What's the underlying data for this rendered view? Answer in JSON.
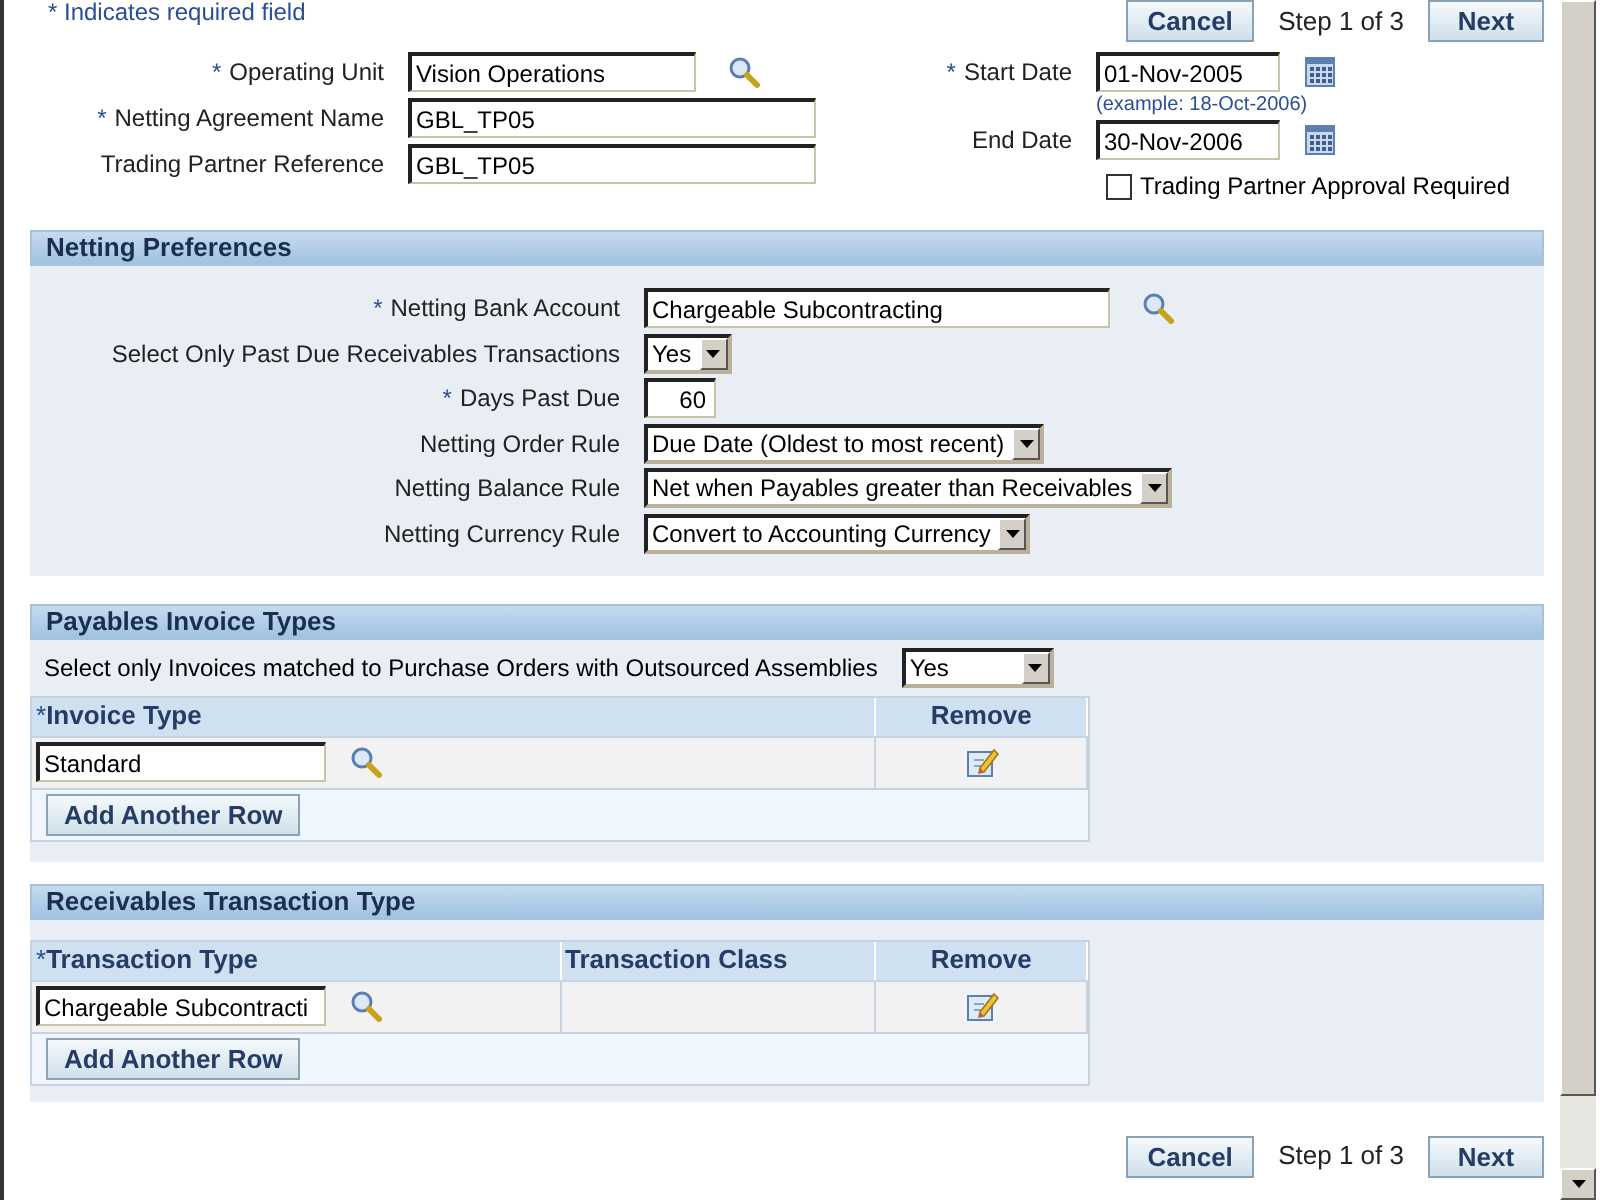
{
  "required_note": "* Indicates required field",
  "top_nav": {
    "cancel": "Cancel",
    "step": "Step 1 of 3",
    "next": "Next"
  },
  "header_left": [
    {
      "label": "Operating Unit",
      "mark": "*",
      "kind": "lov",
      "value": "Vision Operations"
    },
    {
      "label": "Netting Agreement Name",
      "mark": "*",
      "kind": "text",
      "value": "GBL_TP05"
    },
    {
      "label": "Trading Partner Reference",
      "kind": "text",
      "value": "GBL_TP05"
    }
  ],
  "header_right": [
    {
      "label": "Start Date",
      "mark": "*",
      "kind": "date",
      "value": "01-Nov-2005",
      "hint": "(example: 18-Oct-2006)"
    },
    {
      "label": "End Date",
      "kind": "date",
      "value": "30-Nov-2006"
    }
  ],
  "approval_checkbox": {
    "label": "Trading Partner Approval Required",
    "checked": false
  },
  "netting_preferences": {
    "title": "Netting Preferences",
    "fields": [
      {
        "label": "Netting Bank Account",
        "mark": "*",
        "kind": "lov",
        "value": "Chargeable Subcontracting"
      },
      {
        "label": "Select Only Past Due Receivables Transactions",
        "kind": "select",
        "value": "Yes"
      },
      {
        "label": "Days Past Due",
        "mark": "*",
        "kind": "number",
        "value": "60"
      },
      {
        "label": "Netting Order Rule",
        "kind": "select",
        "value": "Due Date (Oldest to most recent)"
      },
      {
        "label": "Netting Balance Rule",
        "kind": "select",
        "value": "Net when Payables greater than Receivables"
      },
      {
        "label": "Netting Currency Rule",
        "kind": "select",
        "value": "Convert to Accounting Currency"
      }
    ]
  },
  "payables_invoice_types": {
    "title": "Payables Invoice Types",
    "filter": {
      "label": "Select only Invoices matched to Purchase Orders with Outsourced Assemblies",
      "value": "Yes"
    },
    "table": {
      "columns": [
        {
          "label": "Invoice Type",
          "mark": "*",
          "kind": "lov"
        },
        {
          "label": "Remove",
          "kind": "remove"
        }
      ],
      "rows": [
        [
          "Standard",
          null
        ]
      ],
      "add_button": "Add Another Row"
    }
  },
  "receivables_transaction_type": {
    "title": "Receivables Transaction Type",
    "table": {
      "columns": [
        {
          "label": "Transaction Type",
          "mark": "*",
          "kind": "lov"
        },
        {
          "label": "Transaction Class",
          "kind": "text"
        },
        {
          "label": "Remove",
          "kind": "remove"
        }
      ],
      "rows": [
        [
          "Chargeable Subcontracti",
          null,
          null
        ]
      ],
      "add_button": "Add Another Row"
    }
  },
  "bottom_nav": {
    "cancel": "Cancel",
    "step": "Step 1 of 3",
    "next": "Next"
  }
}
